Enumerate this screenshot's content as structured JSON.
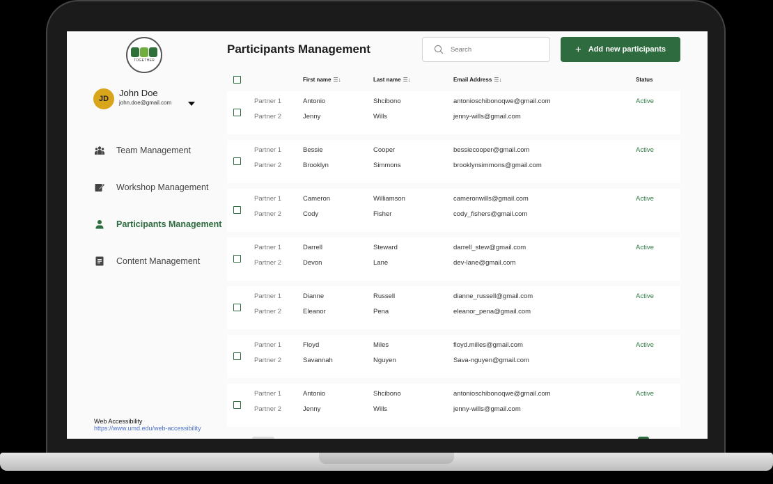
{
  "logo": {
    "text": "TOGETHER"
  },
  "user": {
    "initials": "JD",
    "name": "John Doe",
    "email": "john.doe@gmail.com"
  },
  "nav": [
    {
      "label": "Team Management",
      "icon": "team-icon",
      "active": false
    },
    {
      "label": "Workshop Management",
      "icon": "workshop-icon",
      "active": false
    },
    {
      "label": "Participants Management",
      "icon": "person-icon",
      "active": true
    },
    {
      "label": "Content Management",
      "icon": "document-icon",
      "active": false
    }
  ],
  "footer": {
    "label": "Web Accessibility",
    "link": "https://www.umd.edu/web-accessibility"
  },
  "header": {
    "title": "Participants Management",
    "search_placeholder": "Search",
    "add_label": "Add new participants",
    "add_icon": "+"
  },
  "table": {
    "headers": {
      "first": "First name",
      "last": "Last name",
      "email": "Email Address",
      "status": "Status",
      "sort_icon": "☰↓"
    },
    "rows": [
      {
        "p1": "Partner 1",
        "p2": "Partner 2",
        "first1": "Antonio",
        "first2": "Jenny",
        "last1": "Shcibono",
        "last2": "Wills",
        "email1": "antonioschibonoqwe@gmail.com",
        "email2": "jenny-wills@gmail.com",
        "status": "Active"
      },
      {
        "p1": "Partner 1",
        "p2": "Partner 2",
        "first1": "Bessie",
        "first2": "Brooklyn",
        "last1": "Cooper",
        "last2": "Simmons",
        "email1": "bessiecooper@gmail.com",
        "email2": "brooklynsimmons@gmail.com",
        "status": "Active"
      },
      {
        "p1": "Partner 1",
        "p2": "Partner 2",
        "first1": "Cameron",
        "first2": "Cody",
        "last1": "Williamson",
        "last2": "Fisher",
        "email1": "cameronwills@gmail.com",
        "email2": "cody_fishers@gmail.com",
        "status": "Active"
      },
      {
        "p1": "Partner 1",
        "p2": "Partner 2",
        "first1": "Darrell",
        "first2": "Devon",
        "last1": "Steward",
        "last2": "Lane",
        "email1": "darrell_stew@gmail.com",
        "email2": "dev-lane@gmail.com",
        "status": "Active"
      },
      {
        "p1": "Partner 1",
        "p2": "Partner 2",
        "first1": "Dianne",
        "first2": "Eleanor",
        "last1": "Russell",
        "last2": "Pena",
        "email1": "dianne_russell@gmail.com",
        "email2": "eleanor_pena@gmail.com",
        "status": "Active"
      },
      {
        "p1": "Partner 1",
        "p2": "Partner 2",
        "first1": "Floyd",
        "first2": "Savannah",
        "last1": "Miles",
        "last2": "Nguyen",
        "email1": "floyd.milles@gmail.com",
        "email2": "Sava-nguyen@gmail.com",
        "status": "Active"
      },
      {
        "p1": "Partner 1",
        "p2": "Partner 2",
        "first1": "Antonio",
        "first2": "Jenny",
        "last1": "Shcibono",
        "last2": "Wills",
        "email1": "antonioschibonoqwe@gmail.com",
        "email2": "jenny-wills@gmail.com",
        "status": "Active"
      }
    ]
  },
  "colors": {
    "accent": "#2e6b3e",
    "status": "#2e7a43",
    "avatar": "#d9a51a",
    "link": "#4a6fd0"
  }
}
